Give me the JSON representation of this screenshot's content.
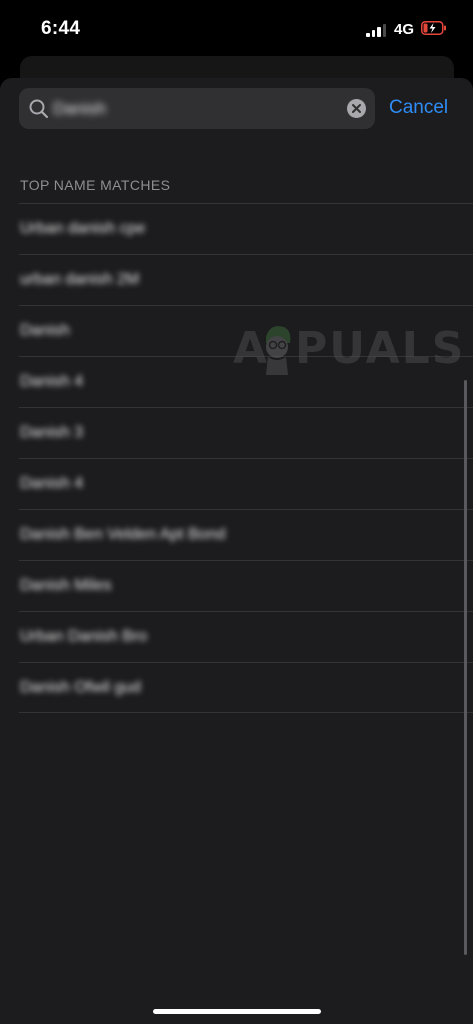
{
  "status_bar": {
    "time": "6:44",
    "network": "4G",
    "battery_icon": "battery-charging-low-icon",
    "signal_icon": "cellular-signal-icon"
  },
  "search": {
    "query": "Danish",
    "clear_icon": "clear-circle-icon",
    "search_icon": "magnifying-glass-icon",
    "cancel_label": "Cancel"
  },
  "section": {
    "header": "TOP NAME MATCHES"
  },
  "results": [
    {
      "label": "Urban danish cpe"
    },
    {
      "label": "urban danish 2M"
    },
    {
      "label": "Danish"
    },
    {
      "label": "Danish 4"
    },
    {
      "label": "Danish 3"
    },
    {
      "label": "Danish 4"
    },
    {
      "label": "Danish Ben Velden Apt Bond"
    },
    {
      "label": "Danish Miles"
    },
    {
      "label": "Urban Danish Bro"
    },
    {
      "label": "Danish Ofwil gud"
    }
  ],
  "watermark": {
    "left": "A",
    "right": "PUALS"
  },
  "colors": {
    "accent": "#2f8cf5",
    "sheet_bg": "#1c1c1e",
    "separator": "#333336",
    "battery_red": "#e5483b"
  }
}
